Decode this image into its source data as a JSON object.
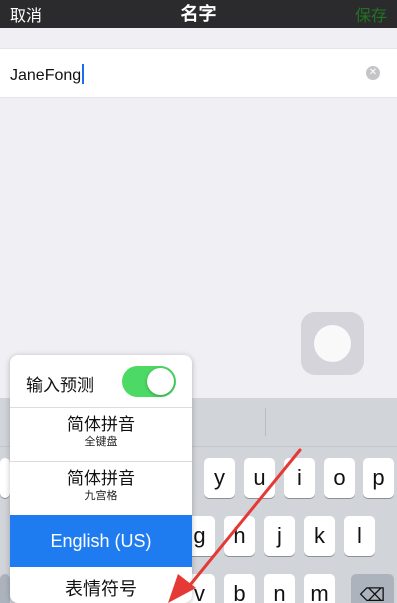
{
  "nav": {
    "cancel_label": "取消",
    "title": "名字",
    "save_label": "保存"
  },
  "name_field": {
    "value": "JaneFong",
    "clear_icon": "clear-circle-icon"
  },
  "keyboard": {
    "row1_keys": [
      "y",
      "u",
      "i",
      "o",
      "p"
    ],
    "row2_keys": [
      "g",
      "h",
      "j",
      "k",
      "l"
    ],
    "row3_keys": [
      "v",
      "b",
      "n",
      "m"
    ],
    "backspace_icon": "backspace-icon",
    "backspace_glyph": "⌫"
  },
  "input_menu": {
    "predictive_label": "输入预测",
    "predictive_enabled": true,
    "items": [
      {
        "label": "简体拼音",
        "sub": "全键盘"
      },
      {
        "label": "简体拼音",
        "sub": "九宫格"
      }
    ],
    "selected_label": "English (US)",
    "emoji_label": "表情符号"
  },
  "colors": {
    "nav_bg": "#2b2b2d",
    "save_green": "#1aad19",
    "toggle_on": "#4cd964",
    "selected_blue": "#1f7cf0",
    "annotation_arrow": "#e53935"
  }
}
